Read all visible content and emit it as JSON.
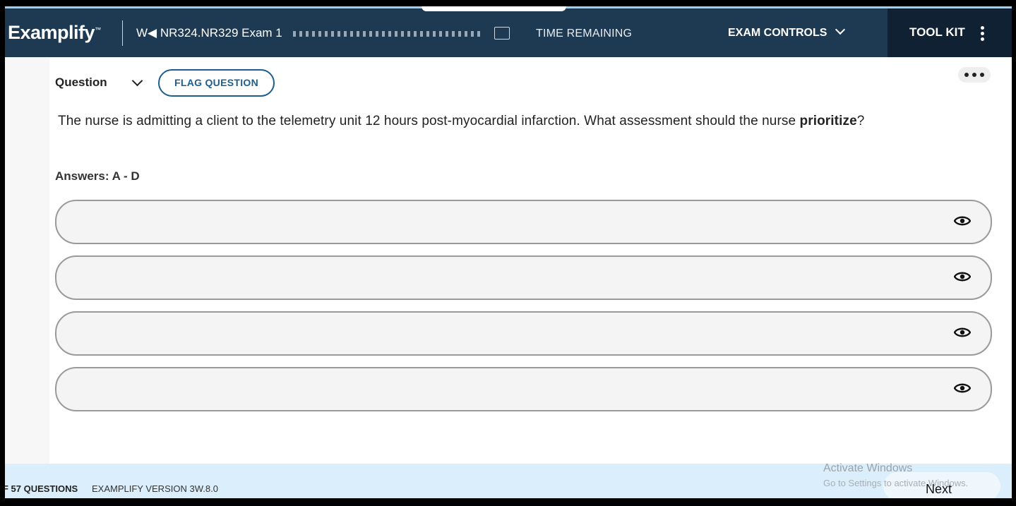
{
  "header": {
    "logo": "Examplify",
    "logo_mark": "™",
    "exam_title": "W◀ NR324.NR329 Exam 1",
    "time_remaining": "TIME REMAINING",
    "exam_controls": "EXAM CONTROLS",
    "tool_kit": "TOOL KIT",
    "colors": {
      "bar": "#1e3a53",
      "toolkit": "#0f2133",
      "accent": "#1b5e8f"
    }
  },
  "question": {
    "label": "Question",
    "flag_label": "FLAG QUESTION",
    "stem_before": "The nurse is admitting a client to the telemetry unit 12 hours post-myocardial infarction. What assessment should the nurse ",
    "stem_bold": "prioritize",
    "stem_after": "?",
    "answers_label": "Answers: A - D"
  },
  "answers": [
    {
      "icon": "eye-icon"
    },
    {
      "icon": "eye-icon"
    },
    {
      "icon": "eye-icon"
    },
    {
      "icon": "eye-icon"
    }
  ],
  "footer": {
    "question_count": "F 57 QUESTIONS",
    "version": "EXAMPLIFY VERSION 3W.8.0",
    "activate_title": "Activate Windows",
    "activate_sub": "Go to Settings to activate Windows.",
    "next_label": "Next"
  }
}
